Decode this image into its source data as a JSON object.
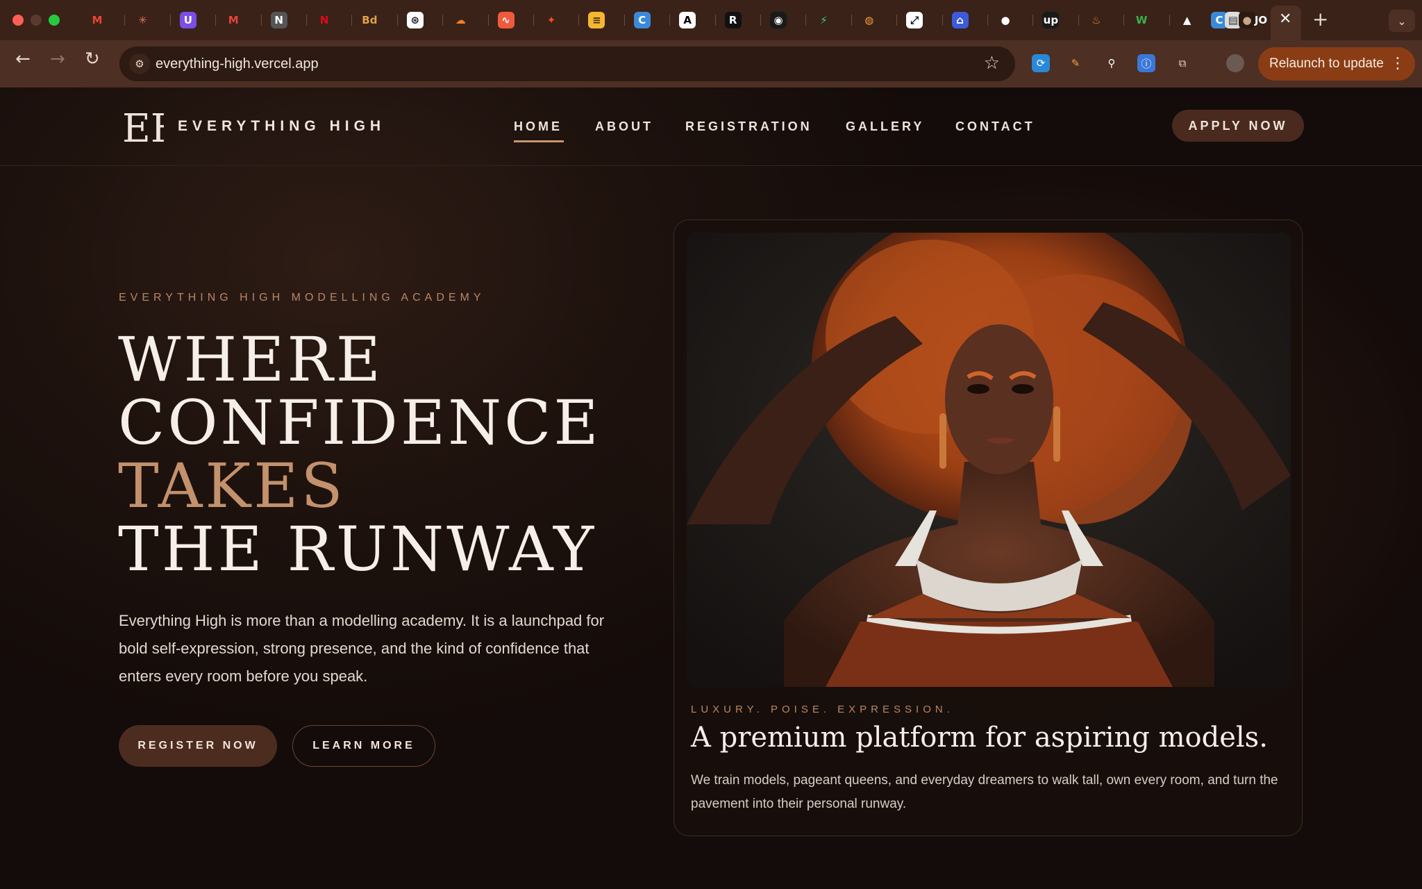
{
  "browser": {
    "url": "everything-high.vercel.app",
    "relaunch_label": "Relaunch to update",
    "new_tab_label": "+",
    "close_tab_label": "✕"
  },
  "tabs": [
    {
      "icon": "gmail-icon",
      "glyph": "M",
      "color": "#ea4335",
      "bg": "transparent"
    },
    {
      "icon": "claude-icon",
      "glyph": "✳",
      "color": "#d97757",
      "bg": "transparent"
    },
    {
      "icon": "proton-icon",
      "glyph": "U",
      "color": "#ffffff",
      "bg": "#7b4ee8"
    },
    {
      "icon": "gmail-icon",
      "glyph": "M",
      "color": "#ea4335",
      "bg": "transparent"
    },
    {
      "icon": "notion-icon",
      "glyph": "N",
      "color": "#ffffff",
      "bg": "#555555"
    },
    {
      "icon": "netflix-icon",
      "glyph": "N",
      "color": "#e50914",
      "bg": "transparent"
    },
    {
      "icon": "bd-icon",
      "glyph": "Bd",
      "color": "#e0a14a",
      "bg": "transparent"
    },
    {
      "icon": "chatgpt-icon",
      "glyph": "⊛",
      "color": "#222222",
      "bg": "#ffffff"
    },
    {
      "icon": "cloudflare-icon",
      "glyph": "☁",
      "color": "#f38020",
      "bg": "transparent"
    },
    {
      "icon": "analytics-icon",
      "glyph": "∿",
      "color": "#ffffff",
      "bg": "#ef5a3c"
    },
    {
      "icon": "figma-icon",
      "glyph": "✦",
      "color": "#f24e1e",
      "bg": "transparent"
    },
    {
      "icon": "layers-icon",
      "glyph": "≡",
      "color": "#3b2a10",
      "bg": "#f5b731"
    },
    {
      "icon": "canva-icon",
      "glyph": "C",
      "color": "#ffffff",
      "bg": "#3b8ad9"
    },
    {
      "icon": "vercel-a-icon",
      "glyph": "A",
      "color": "#000000",
      "bg": "#ffffff"
    },
    {
      "icon": "r-icon",
      "glyph": "R",
      "color": "#ffffff",
      "bg": "#111111"
    },
    {
      "icon": "spotify-icon",
      "glyph": "◉",
      "color": "#ffffff",
      "bg": "#1a1a1a"
    },
    {
      "icon": "supabase-icon",
      "glyph": "⚡",
      "color": "#3ecf8e",
      "bg": "transparent"
    },
    {
      "icon": "globe-icon",
      "glyph": "◍",
      "color": "#f59c3d",
      "bg": "transparent"
    },
    {
      "icon": "zapier-icon",
      "glyph": "⤢",
      "color": "#111111",
      "bg": "#ffffff"
    },
    {
      "icon": "bank-icon",
      "glyph": "⌂",
      "color": "#ffffff",
      "bg": "#3d5bd9"
    },
    {
      "icon": "github-icon",
      "glyph": "●",
      "color": "#ffffff",
      "bg": "transparent"
    },
    {
      "icon": "upwork-icon",
      "glyph": "up",
      "color": "#ffffff",
      "bg": "#1a1a1a"
    },
    {
      "icon": "flame-icon",
      "glyph": "♨",
      "color": "#f08a24",
      "bg": "transparent"
    },
    {
      "icon": "w3-icon",
      "glyph": "W",
      "color": "#3ab14a",
      "bg": "transparent"
    },
    {
      "icon": "triangle-icon",
      "glyph": "▲",
      "color": "#ffffff",
      "bg": "transparent"
    },
    {
      "icon": "canva-icon",
      "glyph": "C",
      "color": "#ffffff",
      "bg": "#3b8ad9"
    },
    {
      "icon": "doc-icon",
      "glyph": "▤",
      "color": "#333333",
      "bg": "#dddddd"
    },
    {
      "icon": "avatar-tab-icon",
      "glyph": "●",
      "color": "#c9a58a",
      "bg": "#2a1a12"
    },
    {
      "icon": "jo-icon",
      "glyph": "JO",
      "color": "#ffffff",
      "bg": "transparent"
    }
  ],
  "extensions": [
    {
      "icon": "translate-extension-icon",
      "glyph": "⟳",
      "color": "#ffffff",
      "bg": "#2a88d8"
    },
    {
      "icon": "pencil-extension-icon",
      "glyph": "✎",
      "color": "#f0a040",
      "bg": "transparent"
    },
    {
      "icon": "eyedropper-extension-icon",
      "glyph": "⚲",
      "color": "#ffffff",
      "bg": "transparent"
    },
    {
      "icon": "info-extension-icon",
      "glyph": "ⓘ",
      "color": "#ffffff",
      "bg": "#3a78d8"
    },
    {
      "icon": "puzzle-extension-icon",
      "glyph": "⧉",
      "color": "#e8d8d0",
      "bg": "transparent"
    }
  ],
  "site": {
    "brand": "EVERYTHING HIGH",
    "logo_text": "EH",
    "nav": [
      "HOME",
      "ABOUT",
      "REGISTRATION",
      "GALLERY",
      "CONTACT"
    ],
    "apply_label": "APPLY NOW",
    "eyebrow": "EVERYTHING HIGH MODELLING ACADEMY",
    "headline": {
      "line1": "WHERE",
      "line2": "CONFIDENCE",
      "line3_accent": "TAKES",
      "line4": "THE RUNWAY"
    },
    "lead": "Everything High is more than a modelling academy. It is a launchpad for bold self-expression, strong presence, and the kind of confidence that enters every room before you speak.",
    "register_label": "REGISTER NOW",
    "learn_label": "LEARN MORE",
    "card": {
      "eyebrow": "LUXURY. POISE. EXPRESSION.",
      "title": "A premium platform for aspiring models.",
      "text": "We train models, pageant queens, and everyday dreamers to walk tall, own every room, and turn the pavement into their personal runway."
    }
  },
  "colors": {
    "accent": "#c3916c",
    "button_fill": "#4d2c20",
    "background": "#140c0a",
    "chrome_tabbar": "#3a2219",
    "chrome_toolbar": "#4d2f24",
    "relaunch": "#8a3d15"
  }
}
